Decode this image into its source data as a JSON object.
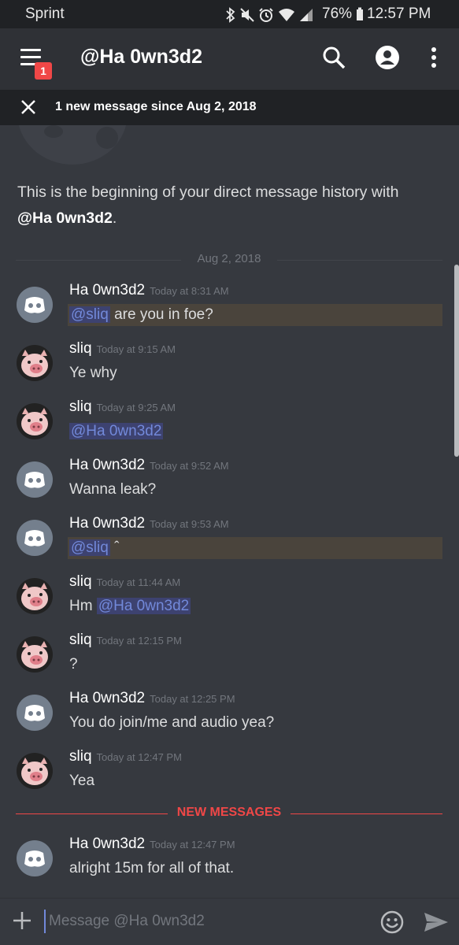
{
  "status_bar": {
    "carrier": "Sprint",
    "battery": "76%",
    "time": "12:57 PM",
    "icons": [
      "bluetooth-icon",
      "mute-icon",
      "alarm-icon",
      "wifi-icon",
      "signal-icon",
      "battery-icon"
    ]
  },
  "header": {
    "title": "@Ha 0wn3d2",
    "menu_badge": "1",
    "icons": [
      "menu-icon",
      "search-icon",
      "profile-icon",
      "more-vert-icon"
    ]
  },
  "notice": {
    "text": "1 new message since Aug 2, 2018"
  },
  "intro": {
    "prefix": "This is the beginning of your direct message history with ",
    "name": "@Ha 0wn3d2",
    "suffix": "."
  },
  "dividers": {
    "date": "Aug 2, 2018",
    "new_messages": "NEW MESSAGES"
  },
  "messages": [
    {
      "author": "Ha 0wn3d2",
      "time": "Today at 8:31 AM",
      "mention": "@sliq",
      "text": " are you in foe?"
    },
    {
      "author": "sliq",
      "time": "Today at 9:15 AM",
      "text": "Ye why"
    },
    {
      "author": "sliq",
      "time": "Today at 9:25 AM",
      "mention": "@Ha 0wn3d2"
    },
    {
      "author": "Ha 0wn3d2",
      "time": "Today at 9:52 AM",
      "text": "Wanna leak?"
    },
    {
      "author": "Ha 0wn3d2",
      "time": "Today at 9:53 AM",
      "mention": "@sliq",
      "text": " ˆ"
    },
    {
      "author": "sliq",
      "time": "Today at 11:44 AM",
      "text": "Hm ",
      "mention": "@Ha 0wn3d2"
    },
    {
      "author": "sliq",
      "time": "Today at 12:15 PM",
      "text": "?"
    },
    {
      "author": "Ha 0wn3d2",
      "time": "Today at 12:25 PM",
      "text": "You do join/me and audio yea?"
    },
    {
      "author": "sliq",
      "time": "Today at 12:47 PM",
      "text": "Yea"
    },
    {
      "author": "Ha 0wn3d2",
      "time": "Today at 12:47 PM",
      "text": "alright 15m for all of that."
    }
  ],
  "composer": {
    "placeholder": "Message @Ha 0wn3d2"
  },
  "colors": {
    "background": "#36393f",
    "header": "#2f3136",
    "blurple": "#7289da",
    "new_messages_red": "#f04747",
    "mention_highlight": "#4a443c"
  }
}
